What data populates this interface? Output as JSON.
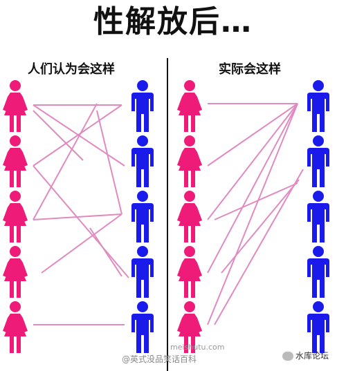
{
  "title": "性解放后…",
  "left_caption": "人们认为会这样",
  "right_caption": "实际会这样",
  "colors": {
    "female": "#ee1c78",
    "male": "#1a1aeb",
    "line": "#e08ac0"
  },
  "icons": {
    "female": "female-figure-icon",
    "male": "male-figure-icon"
  },
  "watermark": {
    "site": "meishutu.com",
    "credit": "@英式没品笑话百科",
    "account": "水库论坛"
  }
}
